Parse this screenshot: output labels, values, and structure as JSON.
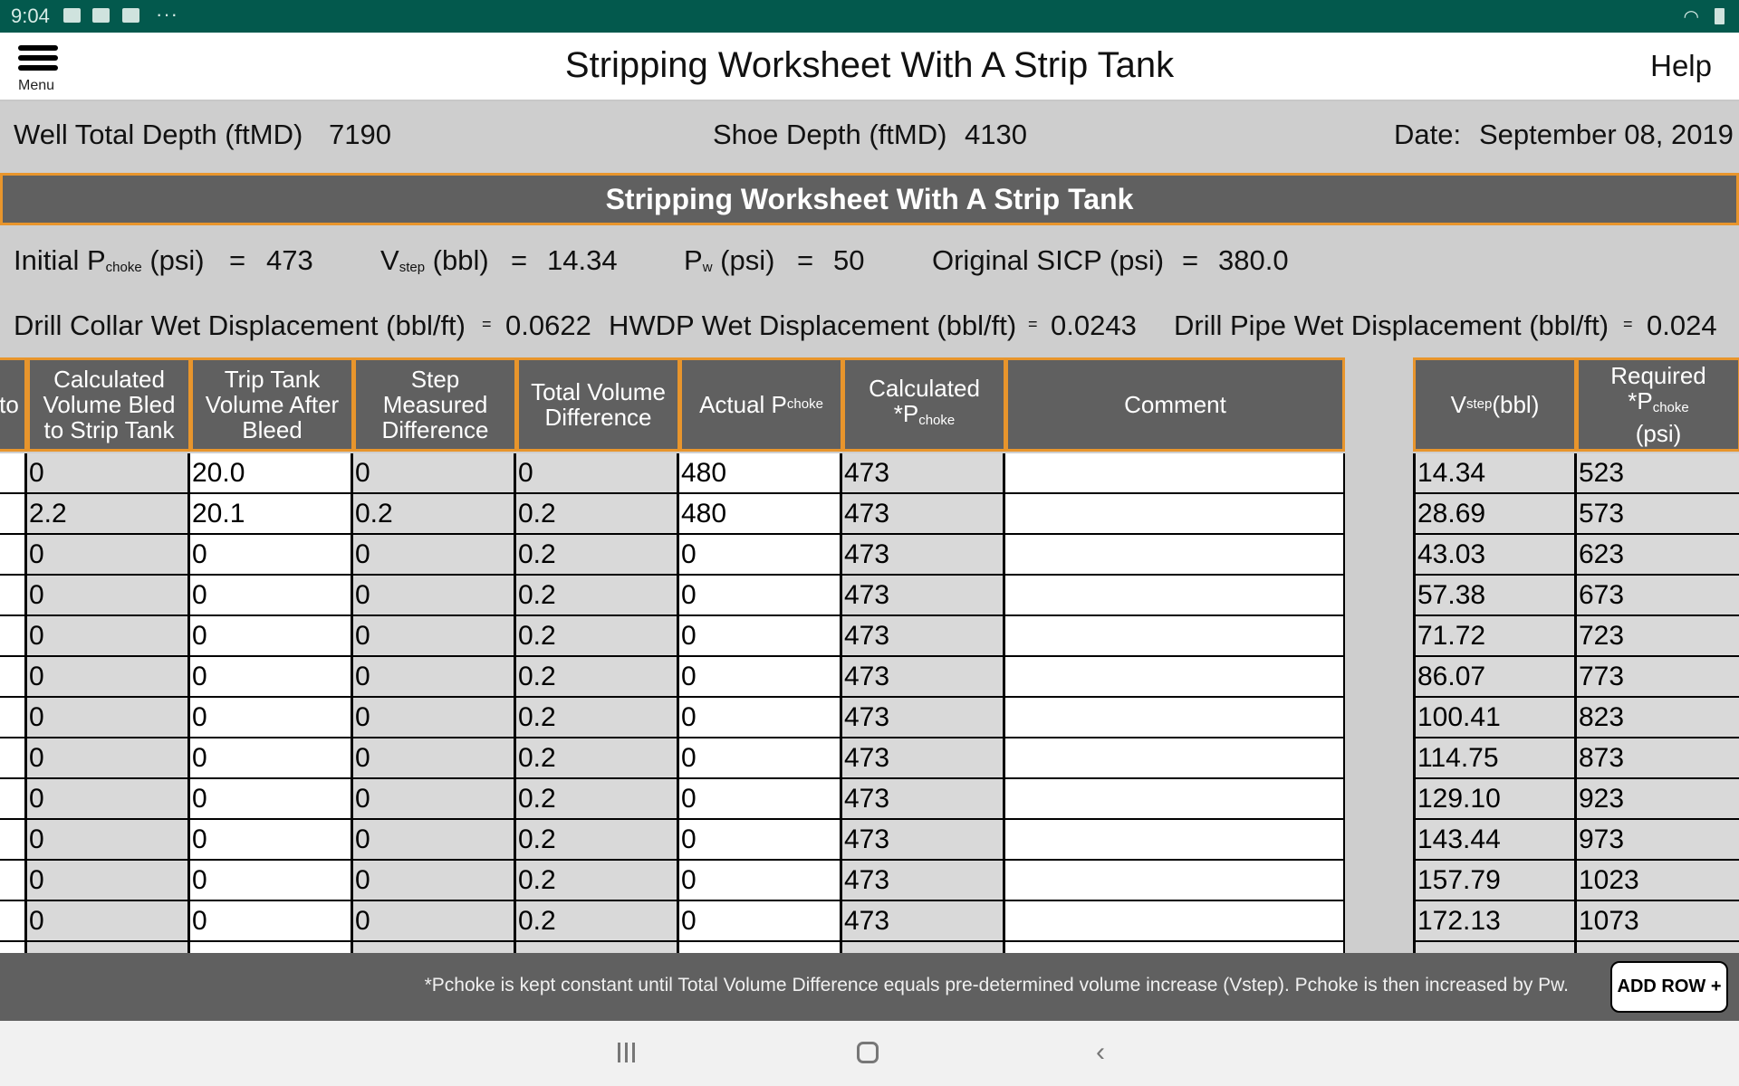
{
  "status_bar": {
    "time": "9:04",
    "icons": [
      "image-icon",
      "mail-error-icon",
      "gmail-icon",
      "more-dots-icon"
    ],
    "more": "···",
    "right_icons": [
      "wifi-icon",
      "battery-icon"
    ]
  },
  "header": {
    "menu_label": "Menu",
    "title": "Stripping Worksheet With A Strip Tank",
    "help_label": "Help"
  },
  "info": {
    "well_depth_label": "Well Total Depth (ftMD)",
    "well_depth_value": "7190",
    "shoe_depth_label": "Shoe Depth (ftMD)",
    "shoe_depth_value": "4130",
    "date_label": "Date:",
    "date_value": "September 08, 2019"
  },
  "section_title": "Stripping Worksheet With A Strip Tank",
  "params": {
    "initial_pchoke": {
      "prefix": "Initial P",
      "sub": "choke",
      "unit": "(psi)",
      "eq": "=",
      "value": "473"
    },
    "vstep": {
      "prefix": "V",
      "sub": "step",
      "unit": "(bbl)",
      "eq": "=",
      "value": "14.34"
    },
    "pw": {
      "prefix": "P",
      "sub": "w",
      "unit": "(psi)",
      "eq": "=",
      "value": "50"
    },
    "sicp": {
      "label": "Original SICP (psi)",
      "eq": "=",
      "value": "380.0"
    },
    "drill_collar": {
      "label": "Drill Collar Wet Displacement (bbl/ft)",
      "eq": "=",
      "value": "0.0622"
    },
    "hwdp": {
      "label": "HWDP Wet Displacement (bbl/ft)",
      "eq": "=",
      "value": "0.0243"
    },
    "drill_pipe": {
      "label": "Drill Pipe Wet Displacement (bbl/ft)",
      "eq": "=",
      "value": "0.024"
    }
  },
  "table": {
    "headers": {
      "partial": "to",
      "calc_volume_bled": "Calculated Volume Bled to Strip Tank",
      "trip_tank_volume": "Trip Tank Volume After Bleed",
      "step_measured_diff": "Step Measured Difference",
      "total_volume_diff": "Total Volume Difference",
      "actual_pchoke": {
        "prefix": "Actual P",
        "sub": "choke"
      },
      "calculated_pchoke": {
        "line1": "Calculated",
        "prefix": "*P",
        "sub": "choke"
      },
      "comment": "Comment",
      "vstep": {
        "prefix": "V",
        "sub": "step",
        "suffix": " (bbl)"
      },
      "required_pchoke": {
        "prefix": "Required *P",
        "sub": "choke",
        "line2": "(psi)"
      }
    },
    "rows": [
      {
        "partial": "",
        "calc_volume_bled": "0",
        "trip_tank_volume": "20.0",
        "step_measured_diff": "0",
        "total_volume_diff": "0",
        "actual_pchoke": "480",
        "calculated_pchoke": "473",
        "comment": ""
      },
      {
        "partial": "",
        "calc_volume_bled": "2.2",
        "trip_tank_volume": "20.1",
        "step_measured_diff": "0.2",
        "total_volume_diff": "0.2",
        "actual_pchoke": "480",
        "calculated_pchoke": "473",
        "comment": ""
      },
      {
        "partial": "",
        "calc_volume_bled": "0",
        "trip_tank_volume": "0",
        "step_measured_diff": "0",
        "total_volume_diff": "0.2",
        "actual_pchoke": "0",
        "calculated_pchoke": "473",
        "comment": ""
      },
      {
        "partial": "",
        "calc_volume_bled": "0",
        "trip_tank_volume": "0",
        "step_measured_diff": "0",
        "total_volume_diff": "0.2",
        "actual_pchoke": "0",
        "calculated_pchoke": "473",
        "comment": ""
      },
      {
        "partial": "",
        "calc_volume_bled": "0",
        "trip_tank_volume": "0",
        "step_measured_diff": "0",
        "total_volume_diff": "0.2",
        "actual_pchoke": "0",
        "calculated_pchoke": "473",
        "comment": ""
      },
      {
        "partial": "",
        "calc_volume_bled": "0",
        "trip_tank_volume": "0",
        "step_measured_diff": "0",
        "total_volume_diff": "0.2",
        "actual_pchoke": "0",
        "calculated_pchoke": "473",
        "comment": ""
      },
      {
        "partial": "",
        "calc_volume_bled": "0",
        "trip_tank_volume": "0",
        "step_measured_diff": "0",
        "total_volume_diff": "0.2",
        "actual_pchoke": "0",
        "calculated_pchoke": "473",
        "comment": ""
      },
      {
        "partial": "",
        "calc_volume_bled": "0",
        "trip_tank_volume": "0",
        "step_measured_diff": "0",
        "total_volume_diff": "0.2",
        "actual_pchoke": "0",
        "calculated_pchoke": "473",
        "comment": ""
      },
      {
        "partial": "",
        "calc_volume_bled": "0",
        "trip_tank_volume": "0",
        "step_measured_diff": "0",
        "total_volume_diff": "0.2",
        "actual_pchoke": "0",
        "calculated_pchoke": "473",
        "comment": ""
      },
      {
        "partial": "",
        "calc_volume_bled": "0",
        "trip_tank_volume": "0",
        "step_measured_diff": "0",
        "total_volume_diff": "0.2",
        "actual_pchoke": "0",
        "calculated_pchoke": "473",
        "comment": ""
      },
      {
        "partial": "",
        "calc_volume_bled": "0",
        "trip_tank_volume": "0",
        "step_measured_diff": "0",
        "total_volume_diff": "0.2",
        "actual_pchoke": "0",
        "calculated_pchoke": "473",
        "comment": ""
      },
      {
        "partial": "",
        "calc_volume_bled": "0",
        "trip_tank_volume": "0",
        "step_measured_diff": "0",
        "total_volume_diff": "0.2",
        "actual_pchoke": "0",
        "calculated_pchoke": "473",
        "comment": ""
      },
      {
        "partial": "",
        "calc_volume_bled": "",
        "trip_tank_volume": "",
        "step_measured_diff": "",
        "total_volume_diff": "",
        "actual_pchoke": "",
        "calculated_pchoke": "",
        "comment": ""
      }
    ],
    "step_rows": [
      {
        "vstep": "14.34",
        "required_pchoke": "523"
      },
      {
        "vstep": "28.69",
        "required_pchoke": "573"
      },
      {
        "vstep": "43.03",
        "required_pchoke": "623"
      },
      {
        "vstep": "57.38",
        "required_pchoke": "673"
      },
      {
        "vstep": "71.72",
        "required_pchoke": "723"
      },
      {
        "vstep": "86.07",
        "required_pchoke": "773"
      },
      {
        "vstep": "100.41",
        "required_pchoke": "823"
      },
      {
        "vstep": "114.75",
        "required_pchoke": "873"
      },
      {
        "vstep": "129.10",
        "required_pchoke": "923"
      },
      {
        "vstep": "143.44",
        "required_pchoke": "973"
      },
      {
        "vstep": "157.79",
        "required_pchoke": "1023"
      },
      {
        "vstep": "172.13",
        "required_pchoke": "1073"
      },
      {
        "vstep": "",
        "required_pchoke": ""
      }
    ]
  },
  "footer": {
    "note": "*Pchoke is kept constant until Total Volume Difference equals pre-determined  volume increase (Vstep). Pchoke is then increased by Pw.",
    "add_row_label": "ADD ROW +"
  },
  "nav": {
    "recent": "recent-apps",
    "home": "home",
    "back": "‹"
  },
  "colors": {
    "status_bar": "#03594d",
    "header_cell": "#606060",
    "accent_border": "#e8952c",
    "calc_cell": "#d9d9d9",
    "page_bg": "#cecece"
  }
}
